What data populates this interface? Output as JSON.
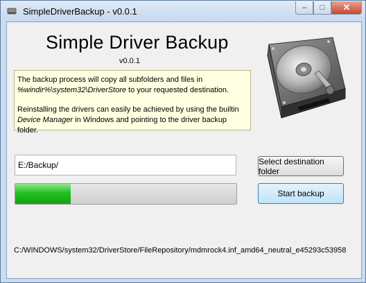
{
  "window": {
    "title": "SimpleDriverBackup - v0.0.1",
    "buttons": {
      "minimize": "–",
      "maximize": "□",
      "close": "✕"
    }
  },
  "header": {
    "title": "Simple Driver Backup",
    "version": "v0.0.1"
  },
  "info": {
    "line1_prefix": "The backup process will copy all subfolders and files in",
    "path": "%windir%\\system32\\DriverStore",
    "line2_suffix": " to your requested destination.",
    "line3_prefix": "Reinstalling the drivers can easily be achieved by using the builtin",
    "device_manager": "Device Manager",
    "line4_suffix": " in Windows and pointing to the driver backup folder."
  },
  "destination": {
    "value": "E:/Backup/"
  },
  "progress": {
    "fraction": 0.25
  },
  "buttons": {
    "select_label": "Select destination folder",
    "start_label": "Start backup"
  },
  "status": {
    "text": "C:/WINDOWS/system32/DriverStore/FileRepository/mdmrock4.inf_amd64_neutral_e45293c53958"
  },
  "colors": {
    "progress_fill": "#22c022",
    "info_background": "#ffffe1",
    "start_button": "#bfe2f8"
  },
  "icons": {
    "app": "hard-drive-icon",
    "illustration": "hard-drive-illustration"
  }
}
